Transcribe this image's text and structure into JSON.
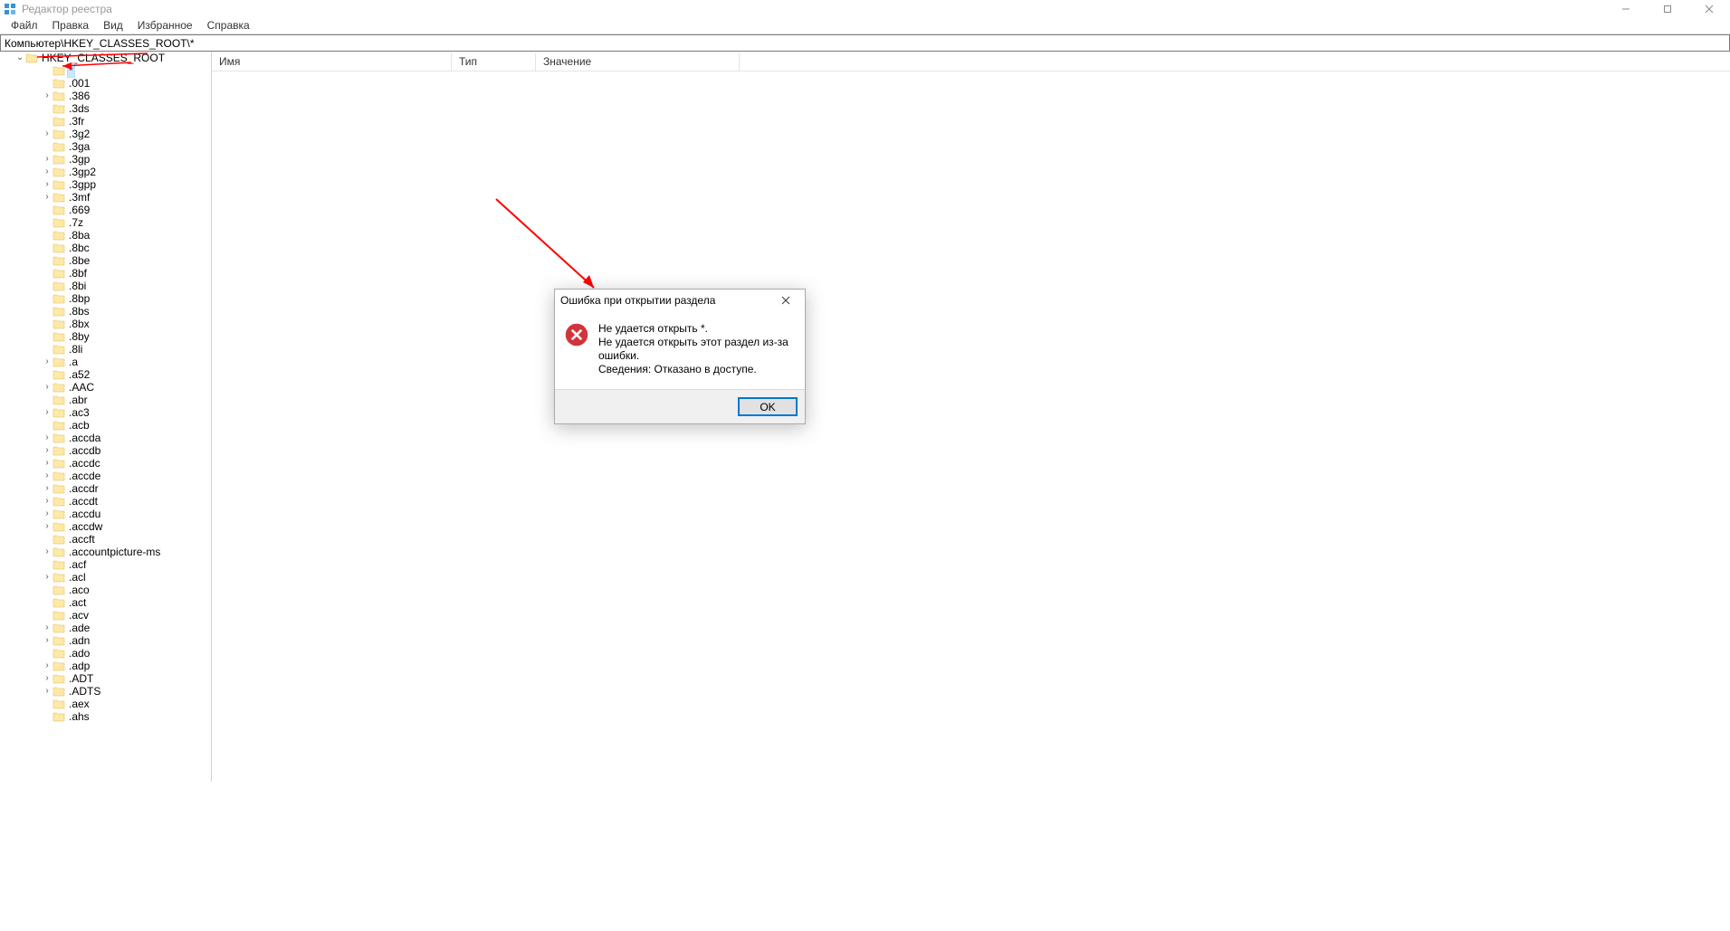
{
  "app": {
    "title": "Редактор реестра"
  },
  "menu": {
    "file": "Файл",
    "edit": "Правка",
    "view": "Вид",
    "favorites": "Избранное",
    "help": "Справка"
  },
  "address": {
    "path": "Компьютер\\HKEY_CLASSES_ROOT\\*"
  },
  "columns": {
    "name": "Имя",
    "type": "Тип",
    "value": "Значение"
  },
  "tree": {
    "root": "HKEY_CLASSES_ROOT",
    "items": [
      {
        "label": "*",
        "expandable": false,
        "selected": true
      },
      {
        "label": ".001",
        "expandable": false
      },
      {
        "label": ".386",
        "expandable": true
      },
      {
        "label": ".3ds",
        "expandable": false
      },
      {
        "label": ".3fr",
        "expandable": false
      },
      {
        "label": ".3g2",
        "expandable": true
      },
      {
        "label": ".3ga",
        "expandable": false
      },
      {
        "label": ".3gp",
        "expandable": true
      },
      {
        "label": ".3gp2",
        "expandable": true
      },
      {
        "label": ".3gpp",
        "expandable": true
      },
      {
        "label": ".3mf",
        "expandable": true
      },
      {
        "label": ".669",
        "expandable": false
      },
      {
        "label": ".7z",
        "expandable": false
      },
      {
        "label": ".8ba",
        "expandable": false
      },
      {
        "label": ".8bc",
        "expandable": false
      },
      {
        "label": ".8be",
        "expandable": false
      },
      {
        "label": ".8bf",
        "expandable": false
      },
      {
        "label": ".8bi",
        "expandable": false
      },
      {
        "label": ".8bp",
        "expandable": false
      },
      {
        "label": ".8bs",
        "expandable": false
      },
      {
        "label": ".8bx",
        "expandable": false
      },
      {
        "label": ".8by",
        "expandable": false
      },
      {
        "label": ".8li",
        "expandable": false
      },
      {
        "label": ".a",
        "expandable": true
      },
      {
        "label": ".a52",
        "expandable": false
      },
      {
        "label": ".AAC",
        "expandable": true
      },
      {
        "label": ".abr",
        "expandable": false
      },
      {
        "label": ".ac3",
        "expandable": true
      },
      {
        "label": ".acb",
        "expandable": false
      },
      {
        "label": ".accda",
        "expandable": true
      },
      {
        "label": ".accdb",
        "expandable": true
      },
      {
        "label": ".accdc",
        "expandable": true
      },
      {
        "label": ".accde",
        "expandable": true
      },
      {
        "label": ".accdr",
        "expandable": true
      },
      {
        "label": ".accdt",
        "expandable": true
      },
      {
        "label": ".accdu",
        "expandable": true
      },
      {
        "label": ".accdw",
        "expandable": true
      },
      {
        "label": ".accft",
        "expandable": false
      },
      {
        "label": ".accountpicture-ms",
        "expandable": true
      },
      {
        "label": ".acf",
        "expandable": false
      },
      {
        "label": ".acl",
        "expandable": true
      },
      {
        "label": ".aco",
        "expandable": false
      },
      {
        "label": ".act",
        "expandable": false
      },
      {
        "label": ".acv",
        "expandable": false
      },
      {
        "label": ".ade",
        "expandable": true
      },
      {
        "label": ".adn",
        "expandable": true
      },
      {
        "label": ".ado",
        "expandable": false
      },
      {
        "label": ".adp",
        "expandable": true
      },
      {
        "label": ".ADT",
        "expandable": true
      },
      {
        "label": ".ADTS",
        "expandable": true
      },
      {
        "label": ".aex",
        "expandable": false
      },
      {
        "label": ".ahs",
        "expandable": false
      }
    ]
  },
  "dialog": {
    "title": "Ошибка при открытии раздела",
    "line1": "Не удается открыть *.",
    "line2": "Не удается открыть этот раздел из-за ошибки.",
    "line3": "Сведения: Отказано в доступе.",
    "ok": "OK"
  }
}
